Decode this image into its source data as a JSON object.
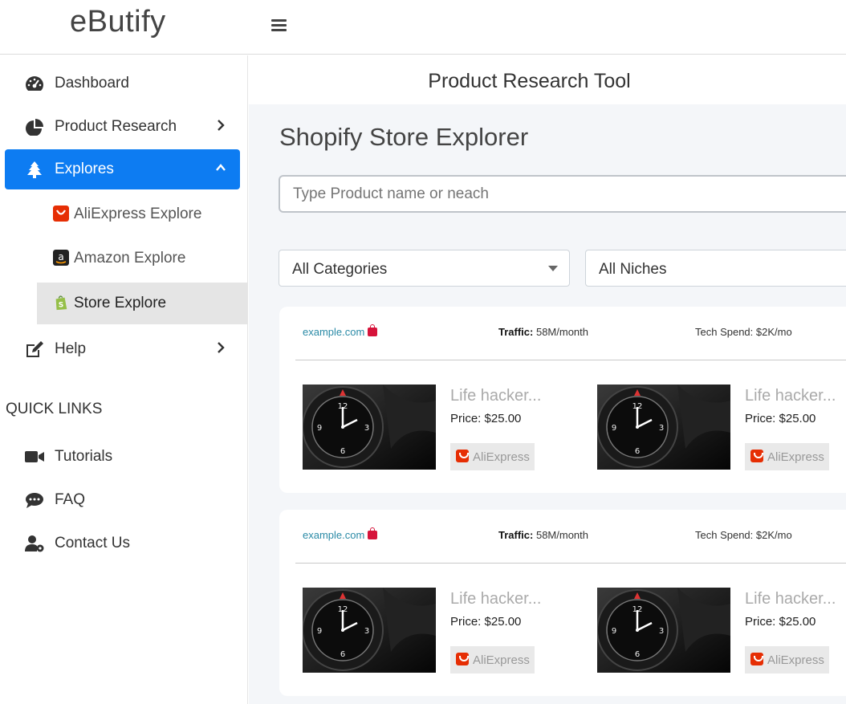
{
  "app": {
    "logo": "eButify"
  },
  "sidebar": {
    "items": [
      {
        "label": "Dashboard",
        "icon": "dashboard-gauge-icon"
      },
      {
        "label": "Product Research",
        "icon": "pie-chart-icon"
      },
      {
        "label": "Explores",
        "icon": "tree-icon",
        "active": true
      },
      {
        "label": "Help",
        "icon": "edit-icon"
      }
    ],
    "sub_items": [
      {
        "label": "AliExpress Explore",
        "icon": "aliexpress-icon"
      },
      {
        "label": "Amazon Explore",
        "icon": "amazon-icon"
      },
      {
        "label": "Store Explore",
        "icon": "shopify-icon",
        "selected": true
      }
    ],
    "quick_links_title": "QUICK LINKS",
    "quick_links": [
      {
        "label": "Tutorials",
        "icon": "video-icon"
      },
      {
        "label": "FAQ",
        "icon": "comments-icon"
      },
      {
        "label": "Contact Us",
        "icon": "user-cog-icon"
      }
    ]
  },
  "main": {
    "header_title": "Product Research Tool",
    "section_title": "Shopify Store Explorer",
    "search_placeholder": "Type Product name or neach",
    "category_select": "All Categories",
    "niche_select": "All Niches",
    "stores": [
      {
        "domain": "example.com",
        "traffic_label": "Traffic:",
        "traffic_value": "58M/month",
        "tech_spend": "Tech Spend: $2K/mo",
        "products": [
          {
            "name": "Life hacker...",
            "price": "Price: $25.00",
            "source": "AliExpress"
          },
          {
            "name": "Life hacker...",
            "price": "Price: $25.00",
            "source": "AliExpress"
          }
        ]
      },
      {
        "domain": "example.com",
        "traffic_label": "Traffic:",
        "traffic_value": "58M/month",
        "tech_spend": "Tech Spend: $2K/mo",
        "products": [
          {
            "name": "Life hacker...",
            "price": "Price: $25.00",
            "source": "AliExpress"
          },
          {
            "name": "Life hacker...",
            "price": "Price: $25.00",
            "source": "AliExpress"
          }
        ]
      }
    ]
  },
  "colors": {
    "accent": "#0d7cf2",
    "link": "#2a8aa6",
    "bag": "#d6133a",
    "aliexpress": "#e62e04"
  }
}
